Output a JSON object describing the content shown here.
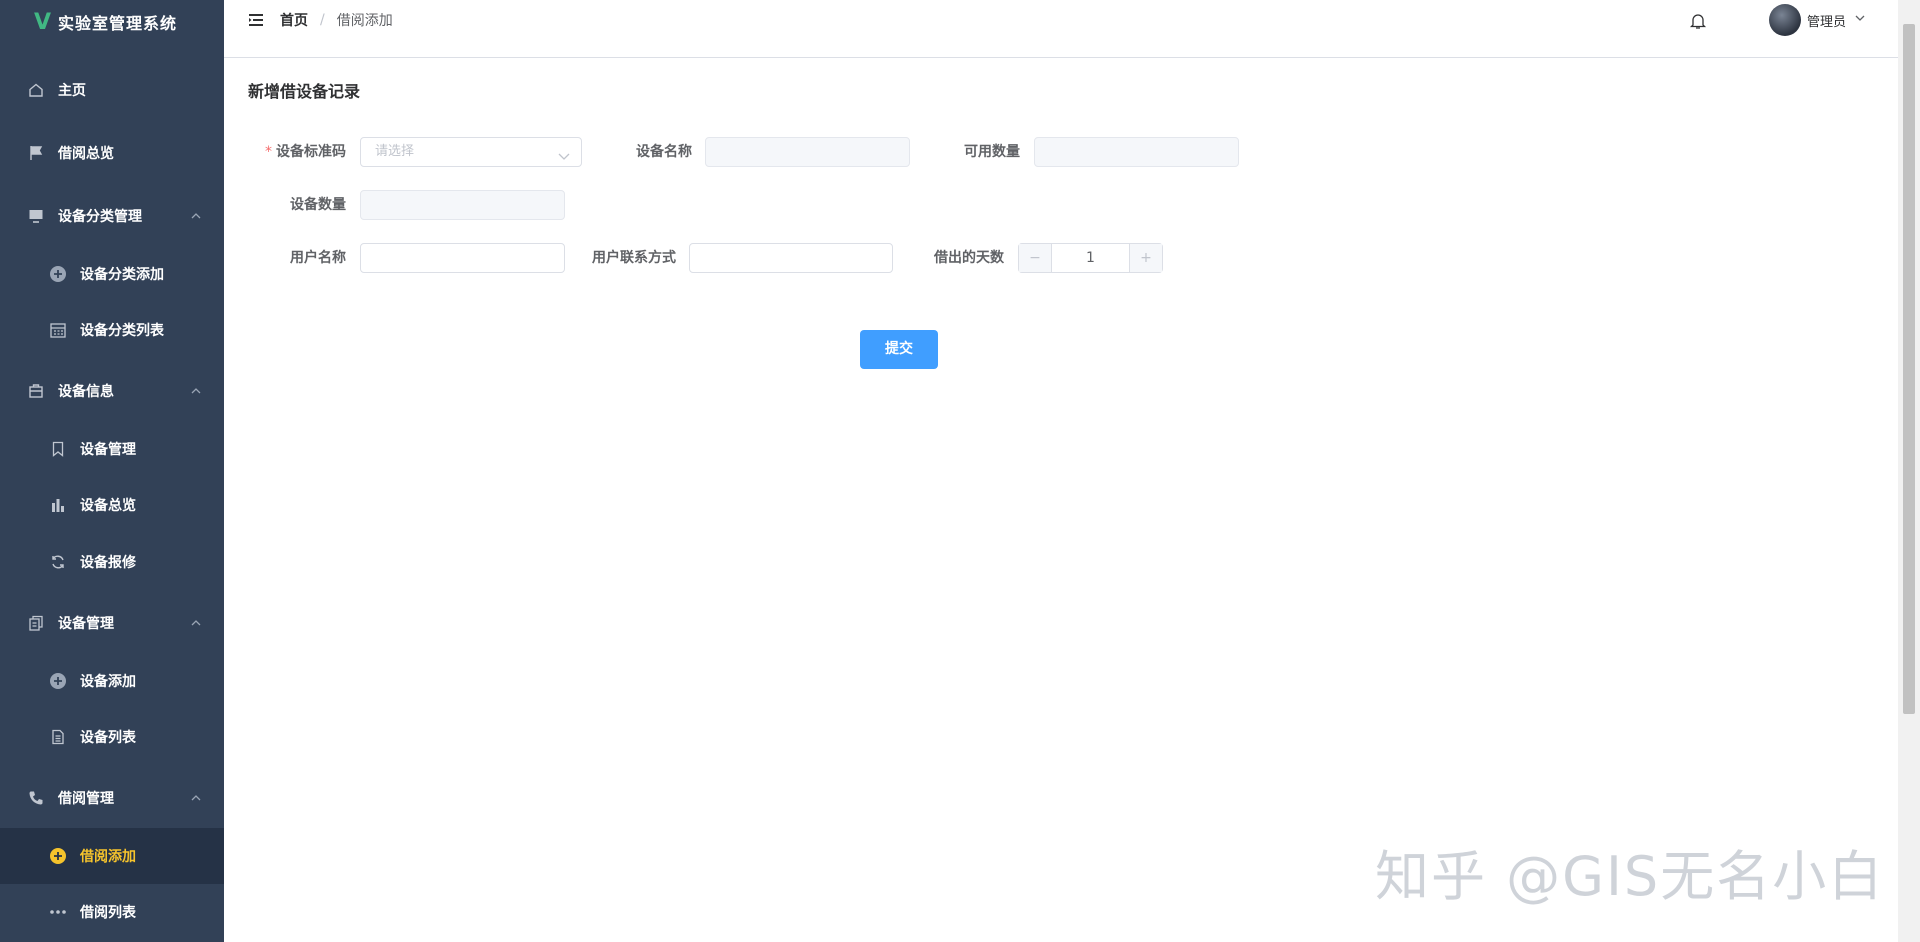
{
  "app": {
    "title": "实验室管理系统",
    "logo_letter": "V"
  },
  "sidebar": {
    "items": [
      {
        "label": "主页",
        "icon": "home-icon"
      },
      {
        "label": "借阅总览",
        "icon": "flag-icon"
      },
      {
        "label": "设备分类管理",
        "icon": "monitor-icon"
      },
      {
        "label": "设备分类添加",
        "icon": "circle-plus-icon"
      },
      {
        "label": "设备分类列表",
        "icon": "calendar-icon"
      },
      {
        "label": "设备信息",
        "icon": "briefcase-icon"
      },
      {
        "label": "设备管理",
        "icon": "bookmark-icon"
      },
      {
        "label": "设备总览",
        "icon": "bar-chart-icon"
      },
      {
        "label": "设备报修",
        "icon": "refresh-icon"
      },
      {
        "label": "设备管理",
        "icon": "copy-document-icon"
      },
      {
        "label": "设备添加",
        "icon": "circle-plus-icon"
      },
      {
        "label": "设备列表",
        "icon": "document-icon"
      },
      {
        "label": "借阅管理",
        "icon": "phone-icon"
      },
      {
        "label": "借阅添加",
        "icon": "circle-plus-icon"
      },
      {
        "label": "借阅列表",
        "icon": "more-icon"
      }
    ],
    "active_item": "借阅添加",
    "active_color": "#f5c32c",
    "bg_color": "#324157"
  },
  "header": {
    "breadcrumb": {
      "home": "首页",
      "separator": "/",
      "current": "借阅添加"
    },
    "user_name": "管理员"
  },
  "form": {
    "title": "新增借设备记录",
    "fields": {
      "code": {
        "label": "设备标准码",
        "placeholder": "请选择",
        "required": true
      },
      "name": {
        "label": "设备名称",
        "value": ""
      },
      "available": {
        "label": "可用数量",
        "value": ""
      },
      "quantity": {
        "label": "设备数量",
        "value": ""
      },
      "username": {
        "label": "用户名称",
        "value": ""
      },
      "contact": {
        "label": "用户联系方式",
        "value": ""
      },
      "days": {
        "label": "借出的天数",
        "value": "1",
        "minus": "−",
        "plus": "+"
      }
    },
    "submit_label": "提交",
    "accent_color": "#409eff"
  },
  "watermark": "知乎 @GIS无名小白"
}
